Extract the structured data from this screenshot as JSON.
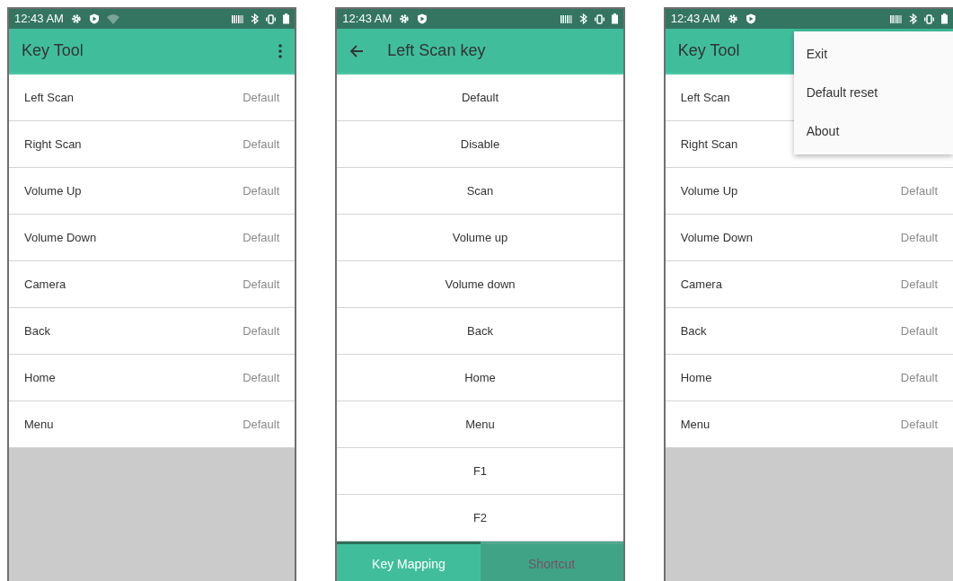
{
  "screens": [
    {
      "kind": "list",
      "status_bar": {
        "time": "12:43 AM",
        "wifi_icon": true
      },
      "app_bar": {
        "title": "Key Tool",
        "back": false,
        "overflow": true
      },
      "rows": [
        {
          "label": "Left Scan",
          "value": "Default"
        },
        {
          "label": "Right Scan",
          "value": "Default"
        },
        {
          "label": "Volume Up",
          "value": "Default"
        },
        {
          "label": "Volume Down",
          "value": "Default"
        },
        {
          "label": "Camera",
          "value": "Default"
        },
        {
          "label": "Back",
          "value": "Default"
        },
        {
          "label": "Home",
          "value": "Default"
        },
        {
          "label": "Menu",
          "value": "Default"
        }
      ]
    },
    {
      "kind": "picker",
      "status_bar": {
        "time": "12:43 AM",
        "wifi_icon": false
      },
      "app_bar": {
        "title": "Left Scan key",
        "back": true,
        "overflow": false
      },
      "options": [
        "Default",
        "Disable",
        "Scan",
        "Volume up",
        "Volume down",
        "Back",
        "Home",
        "Menu",
        "F1",
        "F2"
      ],
      "tabs": [
        {
          "label": "Key Mapping",
          "selected": true
        },
        {
          "label": "Shortcut",
          "selected": false
        }
      ]
    },
    {
      "kind": "list",
      "status_bar": {
        "time": "12:43 AM",
        "wifi_icon": false
      },
      "app_bar": {
        "title": "Key Tool",
        "back": false,
        "overflow": false
      },
      "rows": [
        {
          "label": "Left Scan",
          "value": ""
        },
        {
          "label": "Right Scan",
          "value": ""
        },
        {
          "label": "Volume Up",
          "value": "Default"
        },
        {
          "label": "Volume Down",
          "value": "Default"
        },
        {
          "label": "Camera",
          "value": "Default"
        },
        {
          "label": "Back",
          "value": "Default"
        },
        {
          "label": "Home",
          "value": "Default"
        },
        {
          "label": "Menu",
          "value": "Default"
        }
      ],
      "menu": [
        "Exit",
        "Default reset",
        "About"
      ]
    }
  ]
}
